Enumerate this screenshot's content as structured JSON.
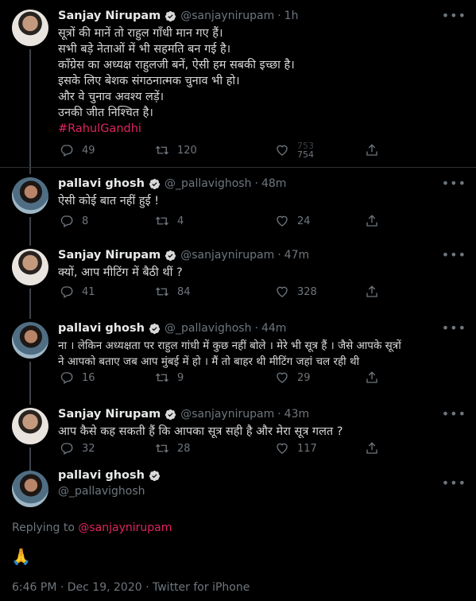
{
  "tweets": [
    {
      "name": "Sanjay Nirupam",
      "handle": "@sanjaynirupam",
      "time": "1h",
      "lines": [
        "सूत्रों की मानें तो राहुल गाँधी मान गए हैं।",
        "सभी बड़े नेताओं में भी सहमति बन गई है।",
        "कॉंग्रेस का अध्यक्ष राहुलजी बनें, ऐसी हम सबकी इच्छा है।",
        "इसके लिए बेशक संगठनात्मक चुनाव भी हो।",
        "और वे चुनाव अवश्य लड़ें।",
        "उनकी जीत निश्चित है।"
      ],
      "hashtag": "#RahulGandhi",
      "replies": "49",
      "retweets": "120",
      "likes_top": "753",
      "likes": "754"
    },
    {
      "name": "pallavi ghosh",
      "handle": "@_pallavighosh",
      "time": "48m",
      "lines": [
        "ऐसी कोई बात नहीं हुई !"
      ],
      "replies": "8",
      "retweets": "4",
      "likes": "24"
    },
    {
      "name": "Sanjay Nirupam",
      "handle": "@sanjaynirupam",
      "time": "47m",
      "lines": [
        "क्यों, आप मीटिंग में बैठी थीं ?"
      ],
      "replies": "41",
      "retweets": "84",
      "likes": "328"
    },
    {
      "name": "pallavi ghosh",
      "handle": "@_pallavighosh",
      "time": "44m",
      "lines": [
        "ना । लेकिन अध्यक्षता पर राहुल गांधी में कुछ नहीं बोले । मेरे भी सूत्र हैं । जैसे आपके सूत्रों",
        "ने आपको बताए जब आप मुंबई में हो । मैं तो बाहर थी मीटिंग जहां चल रही थी"
      ],
      "replies": "16",
      "retweets": "9",
      "likes": "29"
    },
    {
      "name": "Sanjay Nirupam",
      "handle": "@sanjaynirupam",
      "time": "43m",
      "lines": [
        "आप कैसे कह सकती हैं कि आपका सूत्र सही है और मेरा सूत्र गलत ?"
      ],
      "replies": "32",
      "retweets": "28",
      "likes": "117"
    }
  ],
  "focused": {
    "name": "pallavi ghosh",
    "handle": "@_pallavighosh",
    "replying_prefix": "Replying to",
    "replying_to": "@sanjaynirupam",
    "emoji": "🙏",
    "meta": "6:46 PM · Dec 19, 2020 · Twitter for iPhone"
  },
  "icons": {
    "more": "more-icon",
    "verified": "verified-badge-icon",
    "reply": "reply-icon",
    "retweet": "retweet-icon",
    "like": "heart-icon",
    "share": "share-icon"
  },
  "colors": {
    "background": "#000000",
    "hashtag": "#e0245e",
    "muted": "#6e767d",
    "verified": "#d9d9d9"
  }
}
